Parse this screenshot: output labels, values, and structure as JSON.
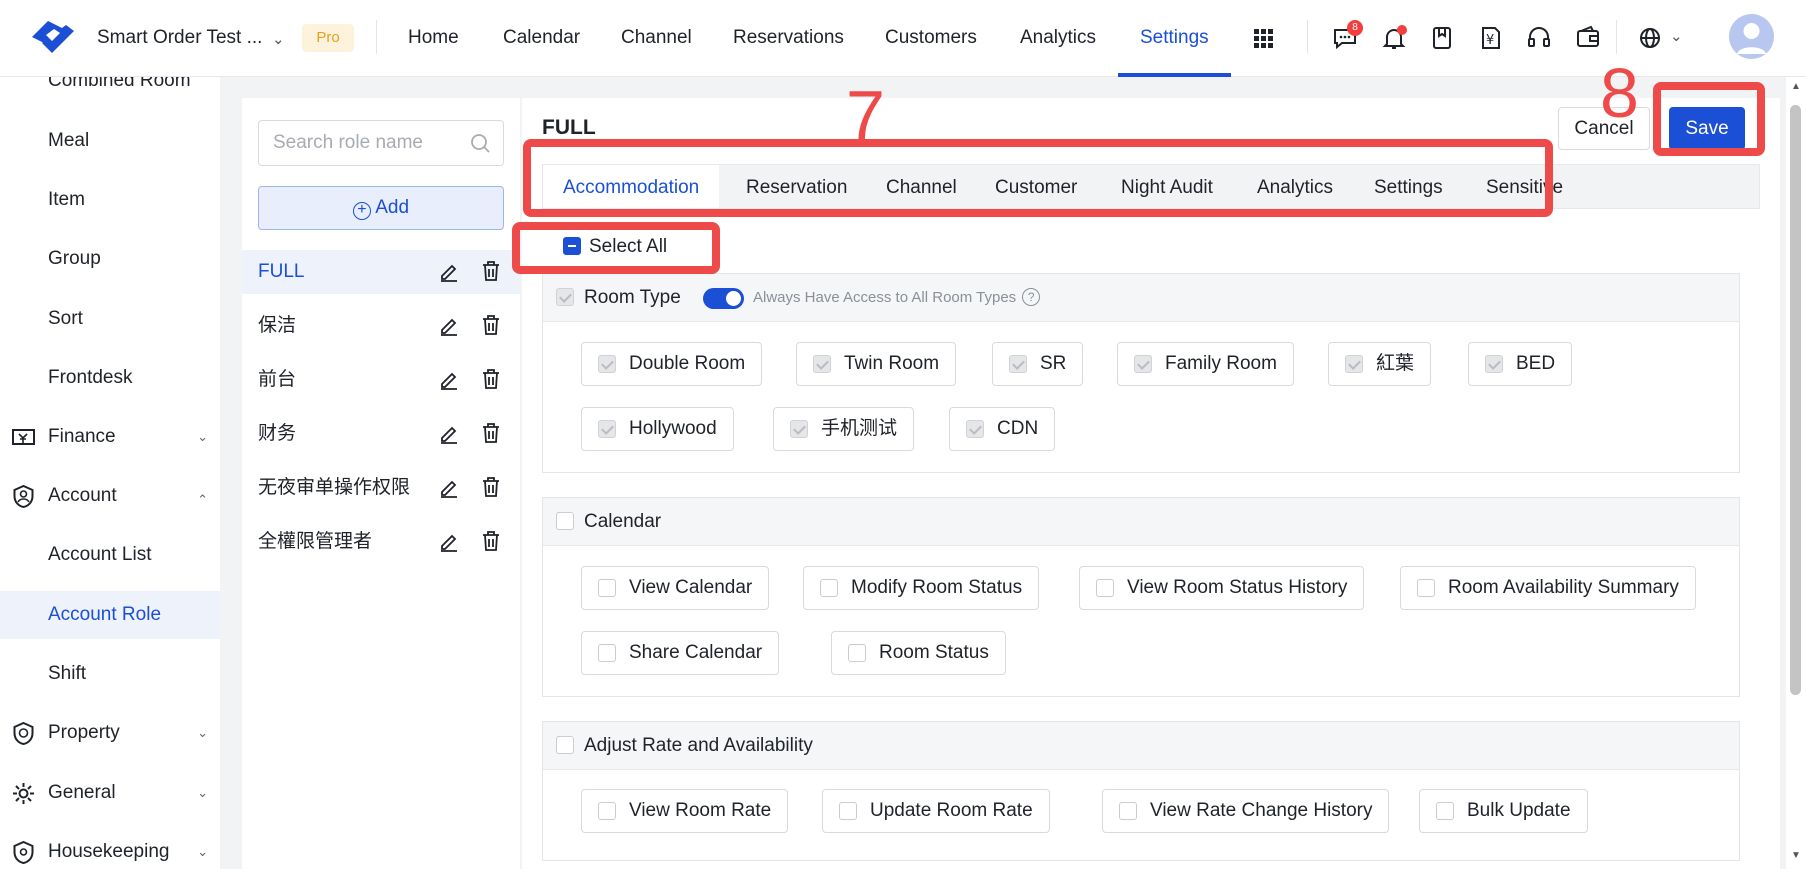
{
  "header": {
    "hotel_name": "Smart Order Test ...",
    "plan_badge": "Pro",
    "nav": [
      "Home",
      "Calendar",
      "Channel",
      "Reservations",
      "Customers",
      "Analytics",
      "Settings"
    ],
    "active_nav": "Settings",
    "message_badge": "8"
  },
  "sidebar": {
    "items": [
      "Combined Room",
      "Meal",
      "Item",
      "Group",
      "Sort",
      "Frontdesk"
    ],
    "groups": {
      "finance": "Finance",
      "account": "Account",
      "property": "Property",
      "general": "General",
      "housekeeping": "Housekeeping"
    },
    "account_items": [
      "Account List",
      "Account Role",
      "Shift"
    ],
    "active_item": "Account Role"
  },
  "roles": {
    "search_placeholder": "Search role name",
    "add_label": "Add",
    "list": [
      "FULL",
      "保洁",
      "前台",
      "财务",
      "无夜审单操作权限",
      "全權限管理者"
    ],
    "active": "FULL"
  },
  "main": {
    "title": "FULL",
    "cancel_label": "Cancel",
    "save_label": "Save",
    "tabs": [
      "Accommodation",
      "Reservation",
      "Channel",
      "Customer",
      "Night Audit",
      "Analytics",
      "Settings",
      "Sensitive"
    ],
    "active_tab": "Accommodation",
    "select_all": "Select All",
    "room_type": {
      "title": "Room Type",
      "toggle_label": "Always Have Access to All Room Types",
      "items": [
        "Double Room",
        "Twin Room",
        "SR",
        "Family Room",
        "紅葉",
        "BED",
        "Hollywood",
        "手机测试",
        "CDN"
      ]
    },
    "calendar": {
      "title": "Calendar",
      "items": [
        "View Calendar",
        "Modify Room Status",
        "View Room Status History",
        "Room Availability Summary",
        "Share Calendar",
        "Room Status"
      ]
    },
    "rate": {
      "title": "Adjust Rate and Availability",
      "items": [
        "View Room Rate",
        "Update Room Rate",
        "View Rate Change History",
        "Bulk Update"
      ]
    }
  },
  "annotations": {
    "tabs_marker": "7",
    "save_marker": "8"
  },
  "colors": {
    "accent": "#1a4fd6",
    "annotation": "#ef4a4a",
    "badge": "#f53f3f"
  }
}
